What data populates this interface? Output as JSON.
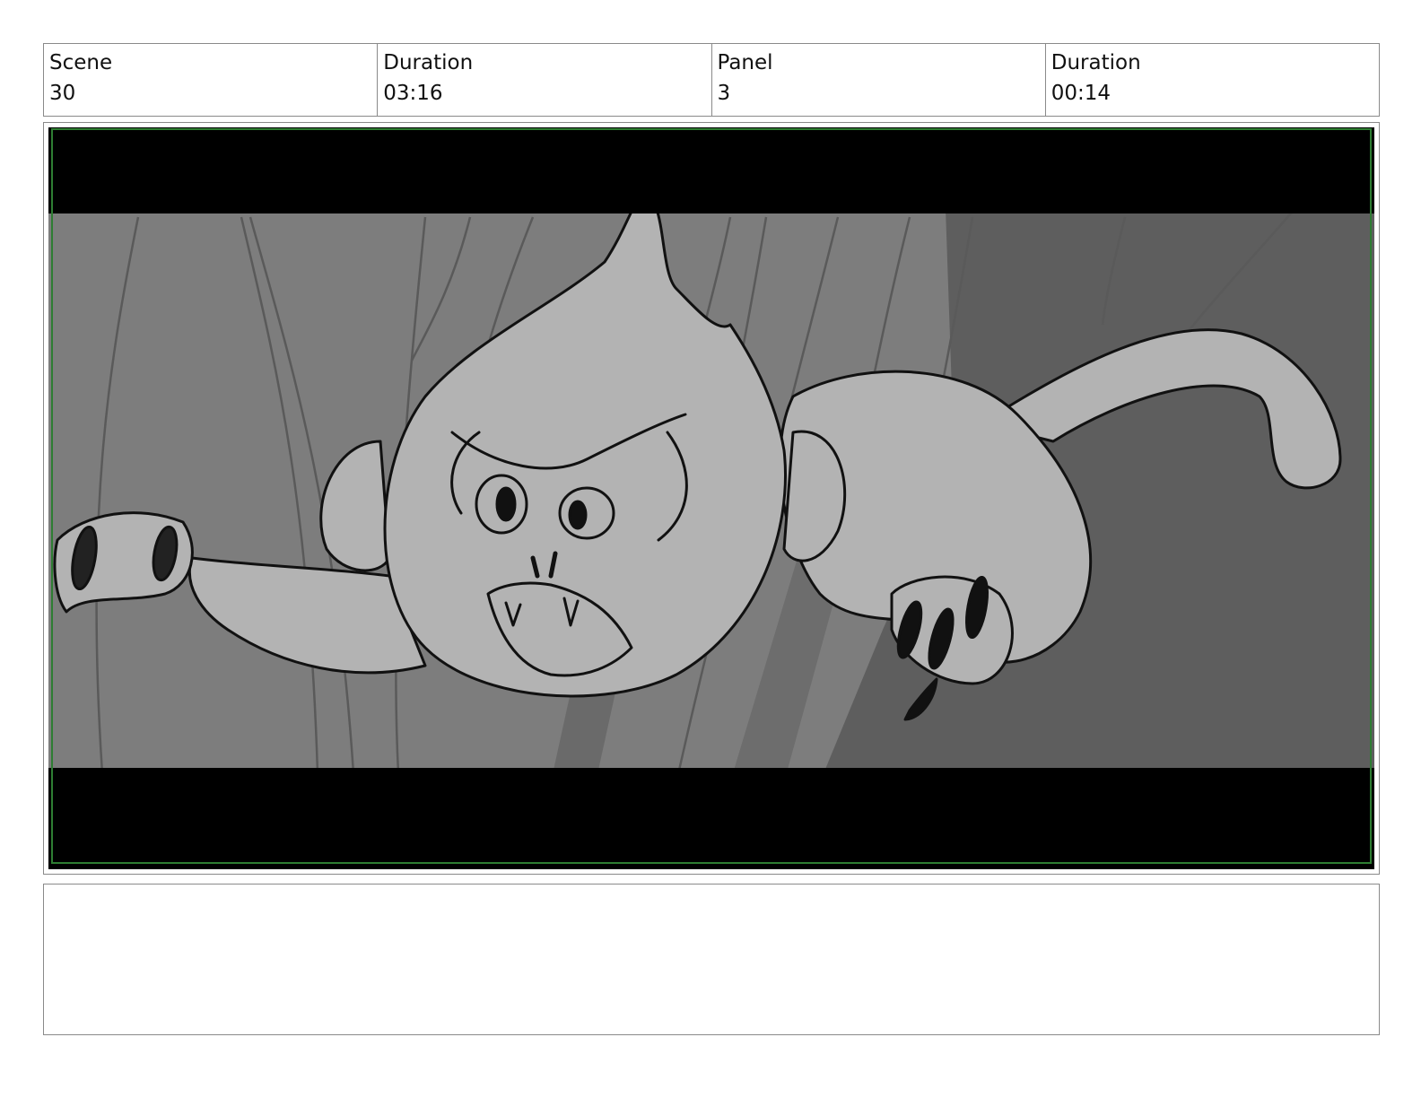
{
  "header": {
    "cells": [
      {
        "label": "Scene",
        "value": "30"
      },
      {
        "label": "Duration",
        "value": "03:16"
      },
      {
        "label": "Panel",
        "value": "3"
      },
      {
        "label": "Duration",
        "value": "00:14"
      }
    ]
  },
  "panel": {
    "illustration": "storyboard-sketch-monkey-leaping",
    "colors": {
      "letterbox": "#000000",
      "safe_frame": "#2e7d32",
      "background_light": "#7d7d7d",
      "background_dark": "#5e5e5e",
      "character_fill": "#b3b3b3",
      "ink": "#111111"
    }
  },
  "notes": {
    "text": ""
  }
}
